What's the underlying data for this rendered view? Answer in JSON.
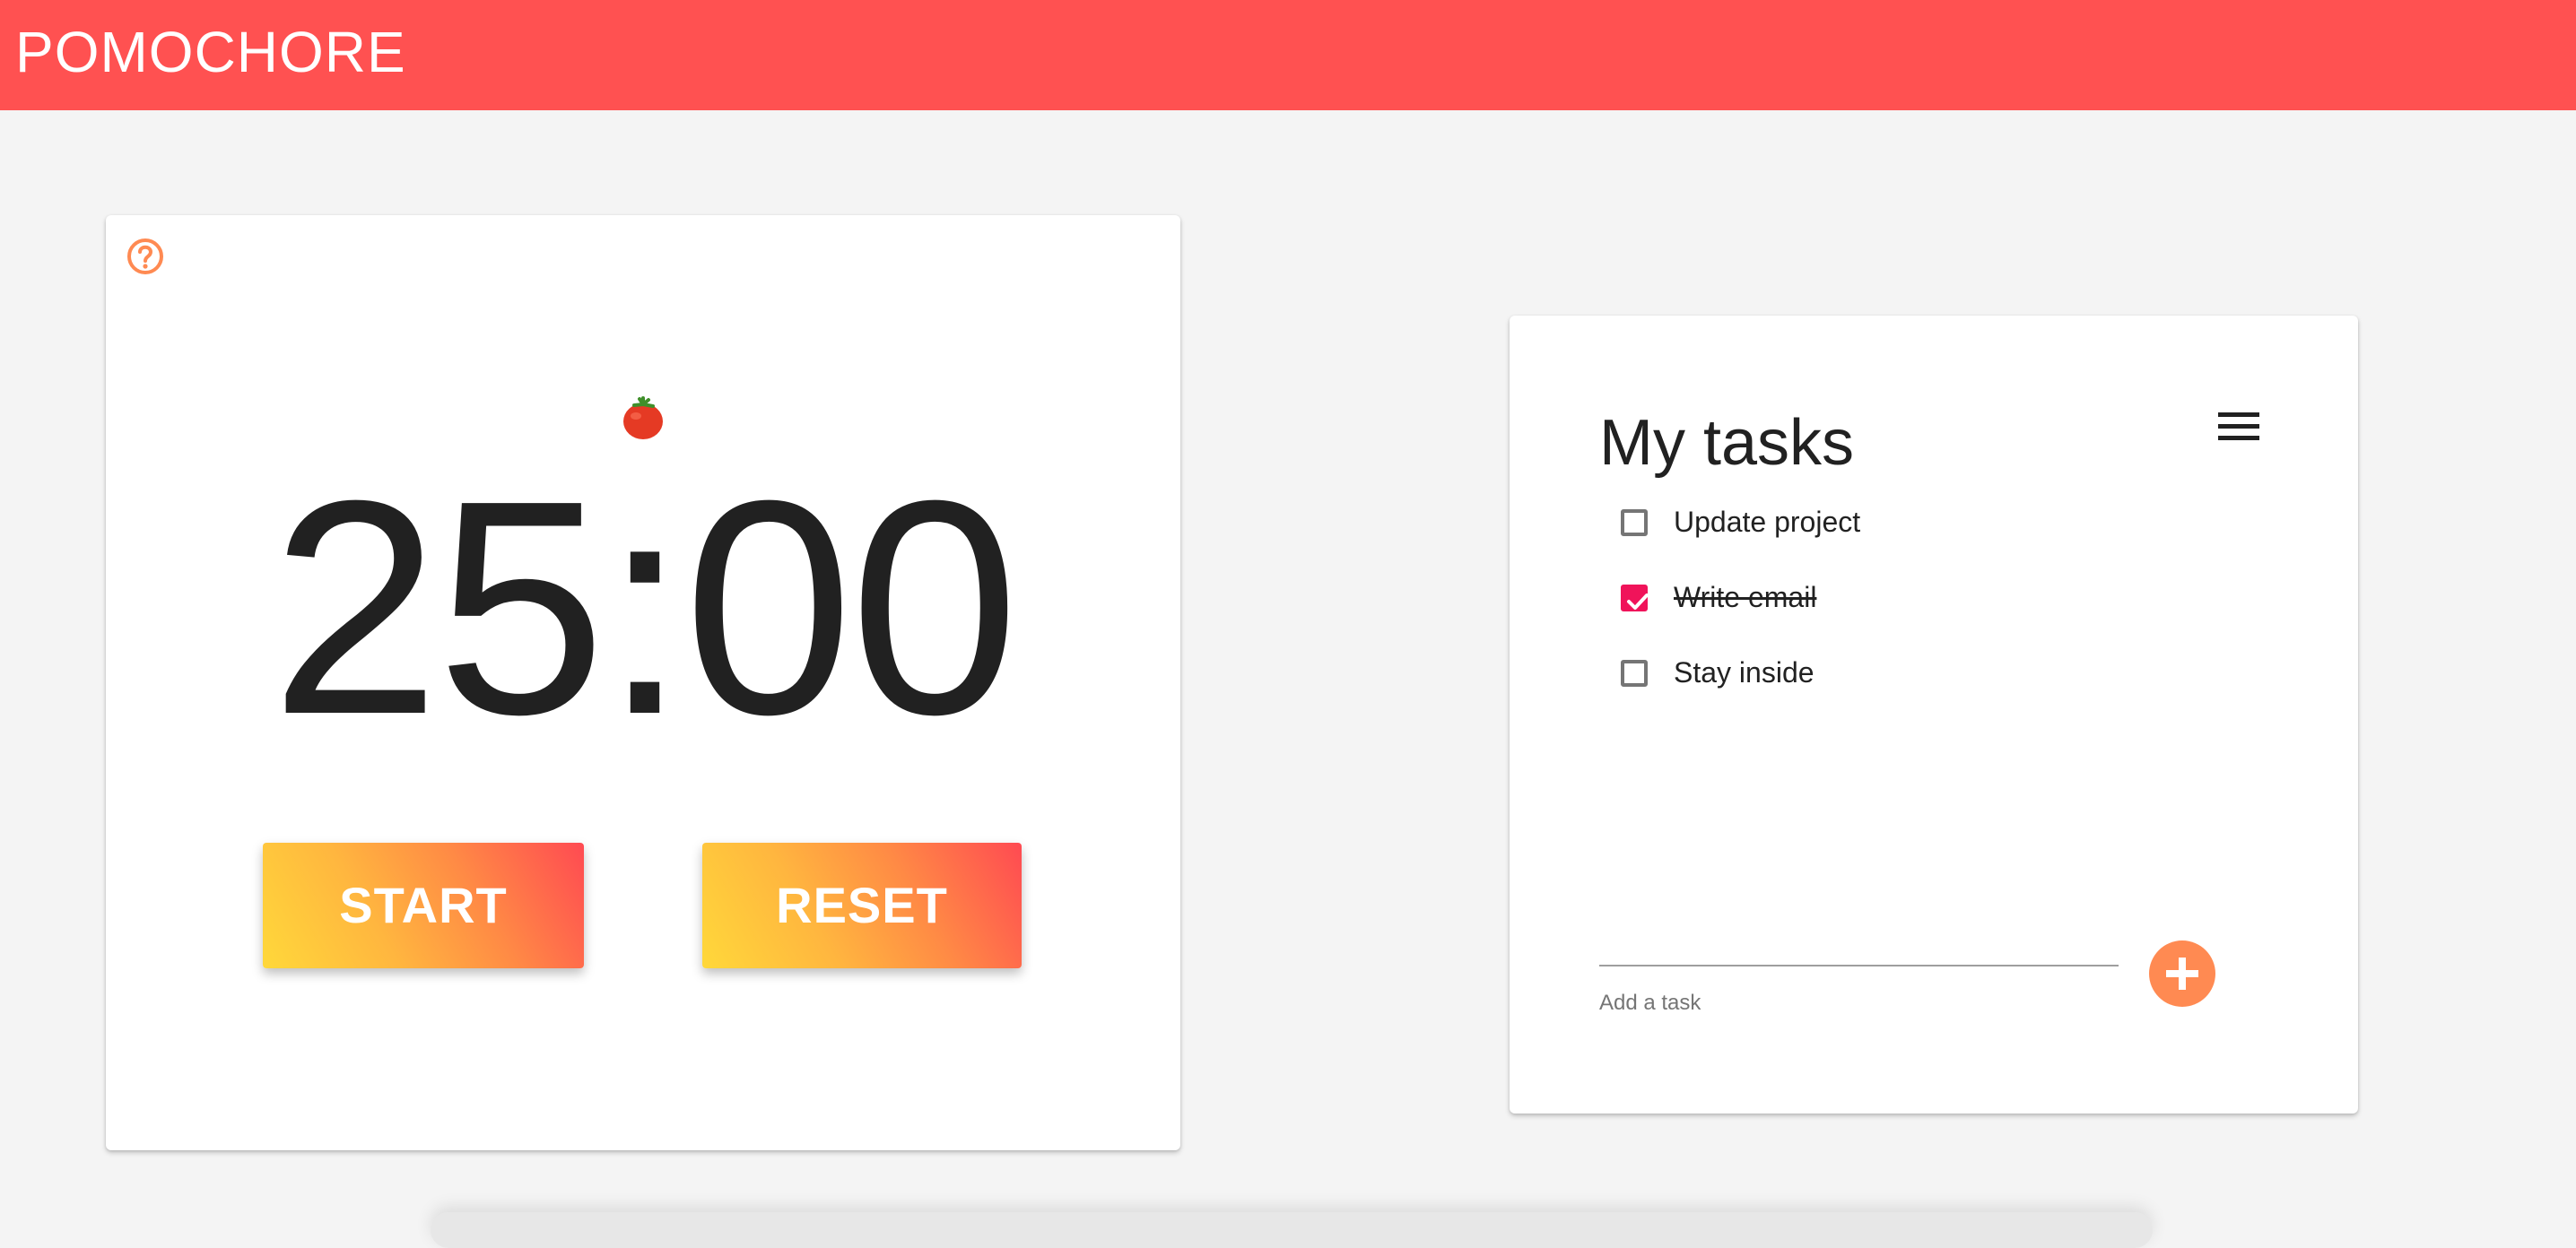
{
  "app": {
    "title": "POMOCHORE",
    "brand_color": "#ff5151"
  },
  "timer": {
    "help_icon": "question-circle-icon",
    "tomato_icon": "tomato-icon",
    "display": "25:00",
    "start_label": "START",
    "reset_label": "RESET"
  },
  "tasks": {
    "title": "My tasks",
    "menu_icon": "hamburger-menu-icon",
    "items": [
      {
        "label": "Update project",
        "checked": false
      },
      {
        "label": "Write email",
        "checked": true
      },
      {
        "label": "Stay inside",
        "checked": false
      }
    ],
    "add_value": "",
    "add_hint": "Add a task",
    "add_icon": "plus-icon",
    "check_color": "#f0135a",
    "accent_color": "#ff8a52"
  }
}
